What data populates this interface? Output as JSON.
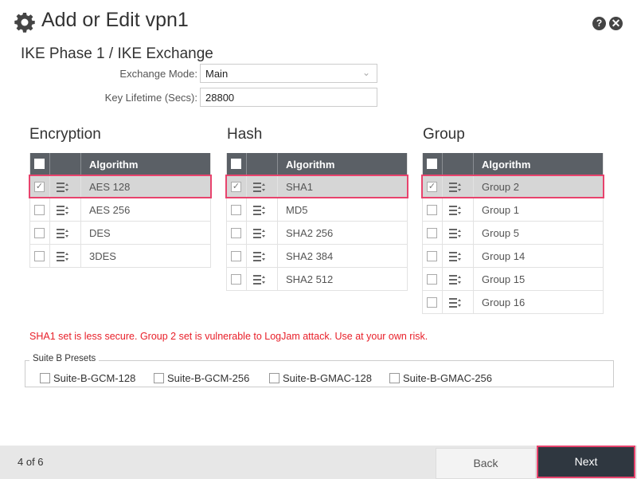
{
  "window": {
    "title": "Add or Edit vpn1",
    "icons": [
      "gear-icon",
      "help-icon",
      "close-icon"
    ],
    "help_glyph": "?",
    "close_glyph": "✕"
  },
  "section": {
    "title": "IKE Phase 1 / IKE Exchange"
  },
  "form": {
    "exchange_mode_label": "Exchange Mode:",
    "exchange_mode_value": "Main",
    "key_lifetime_label": "Key Lifetime (Secs):",
    "key_lifetime_value": "28800"
  },
  "tables": {
    "column_header": "Algorithm",
    "encryption": {
      "heading": "Encryption",
      "rows": [
        {
          "label": "AES 128",
          "checked": true
        },
        {
          "label": "AES 256",
          "checked": false
        },
        {
          "label": "DES",
          "checked": false
        },
        {
          "label": "3DES",
          "checked": false
        }
      ]
    },
    "hash": {
      "heading": "Hash",
      "rows": [
        {
          "label": "SHA1",
          "checked": true
        },
        {
          "label": "MD5",
          "checked": false
        },
        {
          "label": "SHA2 256",
          "checked": false
        },
        {
          "label": "SHA2 384",
          "checked": false
        },
        {
          "label": "SHA2 512",
          "checked": false
        }
      ]
    },
    "group": {
      "heading": "Group",
      "rows": [
        {
          "label": "Group 2",
          "checked": true
        },
        {
          "label": "Group 1",
          "checked": false
        },
        {
          "label": "Group 5",
          "checked": false
        },
        {
          "label": "Group 14",
          "checked": false
        },
        {
          "label": "Group 15",
          "checked": false
        },
        {
          "label": "Group 16",
          "checked": false
        }
      ]
    }
  },
  "warning": "SHA1 set is less secure. Group 2 set is vulnerable to LogJam attack. Use at your own risk.",
  "presets": {
    "legend": "Suite B Presets",
    "items": [
      "Suite-B-GCM-128",
      "Suite-B-GCM-256",
      "Suite-B-GMAC-128",
      "Suite-B-GMAC-256"
    ]
  },
  "footer": {
    "page_indicator": "4 of 6",
    "back_label": "Back",
    "next_label": "Next"
  },
  "colors": {
    "header_bg": "#5b6066",
    "selection_outline": "#e8436d",
    "warning_text": "#e8202a",
    "next_bg": "#2f3740"
  }
}
